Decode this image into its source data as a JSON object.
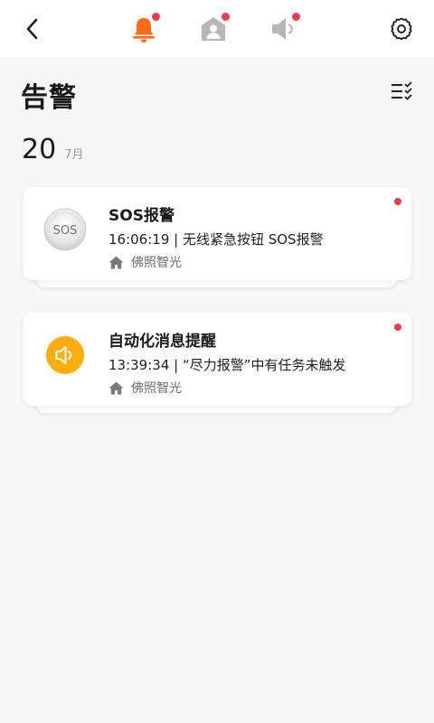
{
  "colors": {
    "accent": "#ff6a1a",
    "badge": "#f0394a",
    "icon_gray": "#b7b7b7",
    "speaker_yellow": "#ffad0d"
  },
  "header": {
    "tabs": [
      {
        "icon": "bell-icon",
        "active": true,
        "has_badge": true
      },
      {
        "icon": "home-person-icon",
        "active": false,
        "has_badge": true
      },
      {
        "icon": "speaker-icon",
        "active": false,
        "has_badge": true
      }
    ]
  },
  "page": {
    "title": "告警"
  },
  "date": {
    "day": "20",
    "month": "7月"
  },
  "alerts": [
    {
      "icon": "sos-button-icon",
      "icon_text": "SOS",
      "title": "SOS报警",
      "detail": "16:06:19 | 无线紧急按钮 SOS报警",
      "location": "佛照智光",
      "unread": true
    },
    {
      "icon": "speaker-icon",
      "title": "自动化消息提醒",
      "detail": "13:39:34 | “尽力报警”中有任务未触发",
      "location": "佛照智光",
      "unread": true
    }
  ]
}
